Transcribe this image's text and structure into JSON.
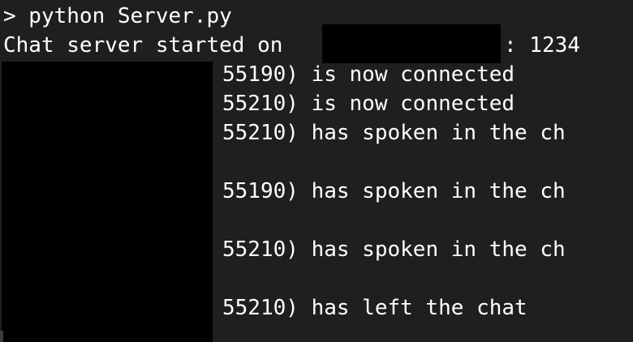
{
  "terminal": {
    "prompt_line": "> python Server.py",
    "started_prefix": "Chat server started on",
    "started_suffix": ": 1234",
    "log": [
      "55190) is now connected",
      "55210) is now connected",
      "55210) has spoken in the ch",
      "55190) has spoken in the ch",
      "55210) has spoken in the ch",
      "55210) has left the chat"
    ]
  },
  "colors": {
    "background": "#1f1f1f",
    "text": "#ffffff",
    "redaction": "#000000"
  }
}
